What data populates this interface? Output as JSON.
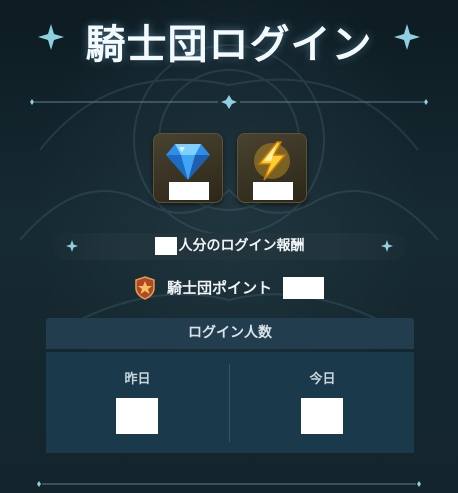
{
  "title": "騎士団ログイン",
  "rewards": [
    {
      "icon": "blue-diamond-icon",
      "count": ""
    },
    {
      "icon": "lightning-bolt-icon",
      "count": ""
    }
  ],
  "reward_banner": {
    "people_count": "",
    "label": "人分のログイン報酬"
  },
  "knight_points": {
    "icon": "knight-shield-emblem-icon",
    "label": "騎士団ポイント",
    "value": ""
  },
  "login_stats": {
    "header": "ログイン人数",
    "yesterday_label": "昨日",
    "yesterday_value": "",
    "today_label": "今日",
    "today_value": ""
  },
  "colors": {
    "background": "#13242c",
    "accent": "#8fd0e0",
    "stats_panel": "#1a3a4c",
    "stats_header": "#213d4e",
    "tile_gold": "#4a4230"
  }
}
